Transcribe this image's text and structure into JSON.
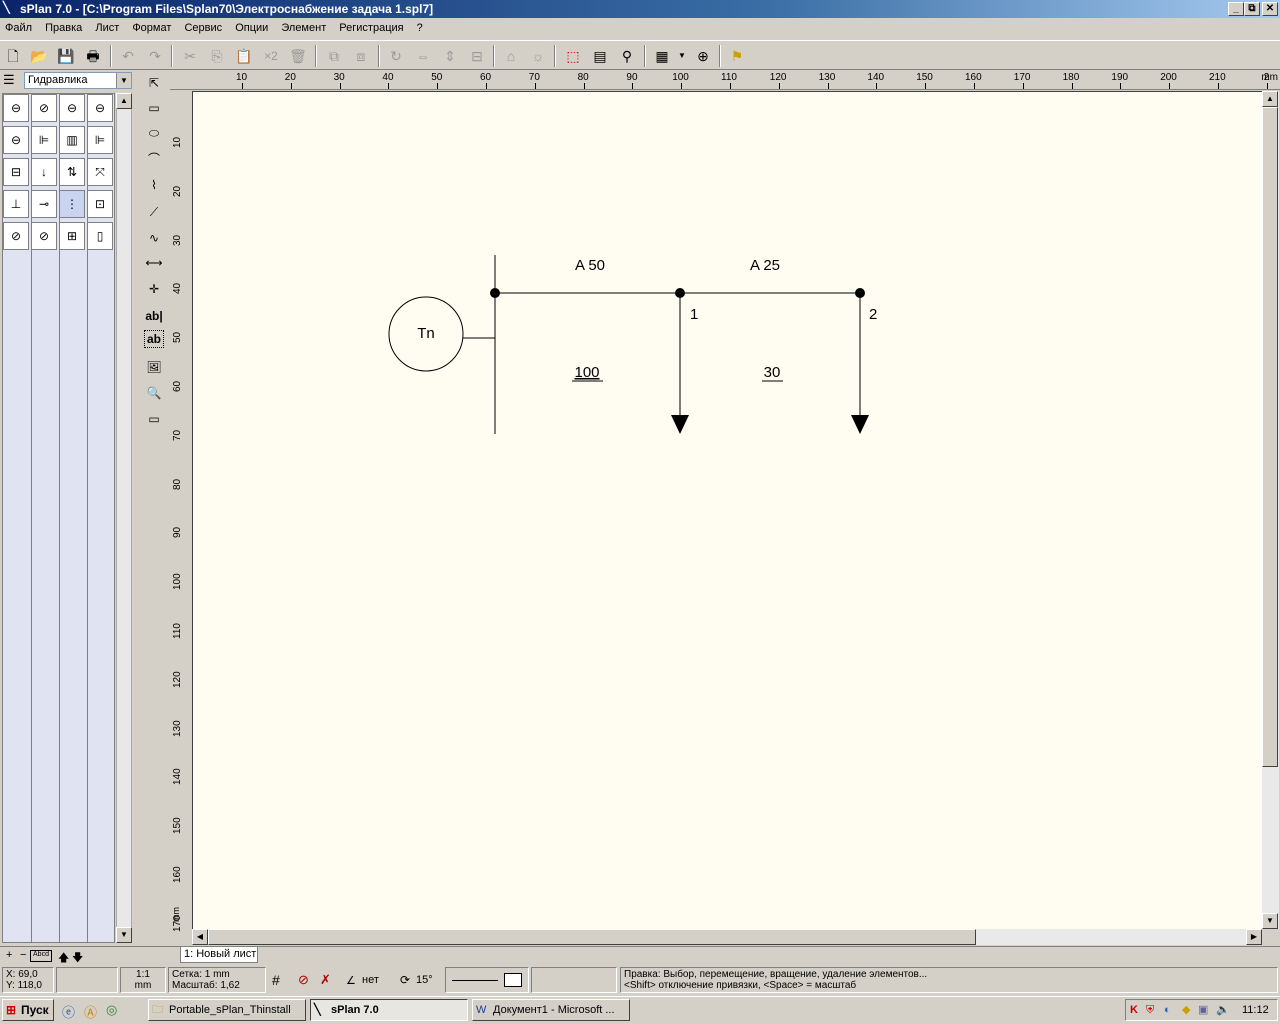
{
  "window": {
    "title": "sPlan 7.0 - [C:\\Program Files\\Splan70\\Электроснабжение задача 1.spl7]",
    "min_label": "_",
    "max_label": "⧉",
    "close_label": "✕"
  },
  "menu": [
    "Файл",
    "Правка",
    "Лист",
    "Формат",
    "Сервис",
    "Опции",
    "Элемент",
    "Регистрация",
    "?"
  ],
  "toolbar": {
    "x2_label": "×2"
  },
  "library": {
    "selected": "Гидравлика"
  },
  "ruler": {
    "unit": "mm",
    "top_ticks": [
      "10",
      "20",
      "30",
      "40",
      "50",
      "60",
      "70",
      "80",
      "90",
      "100",
      "110",
      "120",
      "130",
      "140",
      "150",
      "160",
      "170",
      "180",
      "190",
      "200",
      "210",
      "2"
    ],
    "left_ticks": [
      "10",
      "20",
      "30",
      "40",
      "50",
      "60",
      "70",
      "80",
      "90",
      "100",
      "110",
      "120",
      "130",
      "140",
      "150",
      "160",
      "170"
    ],
    "left_unit": "mm"
  },
  "diagram": {
    "source_label": "Tn",
    "segment1_label": "A 50",
    "segment2_label": "A 25",
    "node1_label": "1",
    "node2_label": "2",
    "load1_value": "100",
    "load2_value": "30"
  },
  "sheet_tab": "1: Новый лист",
  "status": {
    "x": "X: 69,0",
    "y": "Y: 118,0",
    "scale_ratio": "1:1",
    "scale_unit": "mm",
    "grid": "Сетка: 1 mm",
    "zoom": "Масштаб:   1,62",
    "snap": "нет",
    "angle": "15°",
    "hint1": "Правка: Выбор, перемещение, вращение, удаление элементов...",
    "hint2": "<Shift> отключение привязки, <Space> = масштаб"
  },
  "taskbar": {
    "start": "Пуск",
    "tasks": [
      "Portable_sPlan_Thinstall",
      "sPlan 7.0",
      "Документ1 - Microsoft ..."
    ],
    "clock": "11:12"
  }
}
